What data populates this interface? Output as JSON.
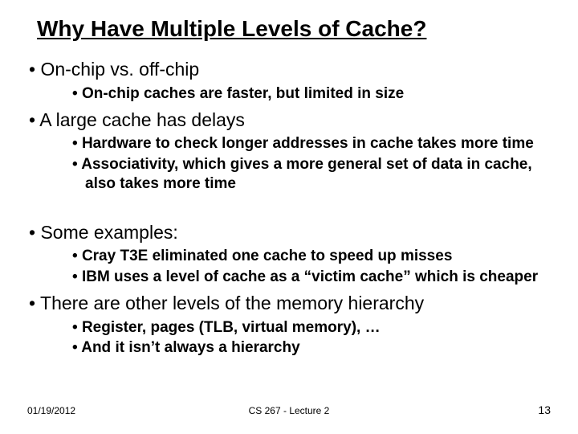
{
  "title": "Why Have Multiple Levels of Cache?",
  "bullets": [
    {
      "text": "On-chip vs. off-chip",
      "sub": [
        "On-chip caches are faster, but limited in size"
      ]
    },
    {
      "text": "A large cache has delays",
      "sub": [
        "Hardware to check longer addresses in cache takes more time",
        "Associativity, which gives a more general set of data in cache, also takes more time"
      ]
    },
    {
      "text": "Some examples:",
      "gap": "lg",
      "sub": [
        "Cray T3E eliminated one cache to speed up misses",
        "IBM uses a level of cache as a “victim cache” which is cheaper"
      ]
    },
    {
      "text": "There are other levels of the memory hierarchy",
      "sub": [
        "Register, pages (TLB, virtual memory), …",
        "And it isn’t always a hierarchy"
      ]
    }
  ],
  "footer": {
    "date": "01/19/2012",
    "center": "CS 267 - Lecture 2",
    "page": "13"
  }
}
